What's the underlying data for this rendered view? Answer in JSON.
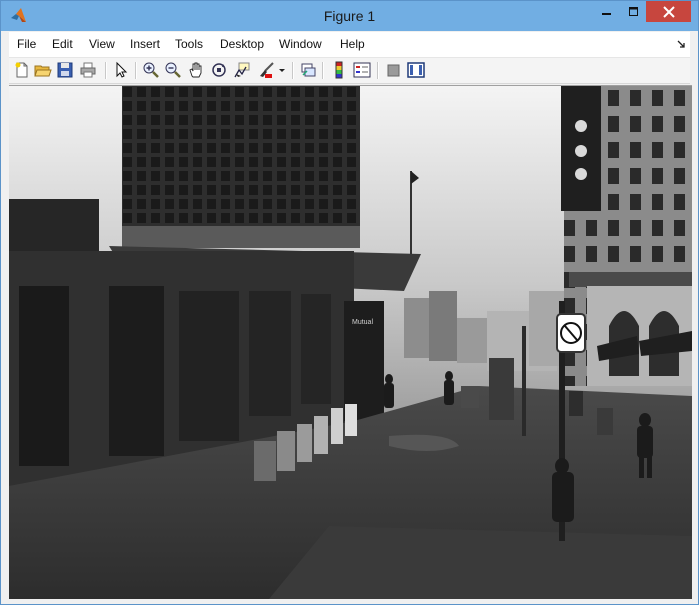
{
  "window": {
    "title": "Figure 1"
  },
  "menubar": {
    "items": [
      "File",
      "Edit",
      "View",
      "Insert",
      "Tools",
      "Desktop",
      "Window",
      "Help"
    ]
  },
  "toolbar": {
    "icons": [
      "new-figure-icon",
      "open-folder-icon",
      "save-icon",
      "print-icon",
      "pointer-icon",
      "zoom-in-icon",
      "zoom-out-icon",
      "pan-hand-icon",
      "rotate-3d-icon",
      "data-cursor-icon",
      "brush-icon",
      "dropdown-arrow-icon",
      "link-plot-icon",
      "colorbar-icon",
      "legend-icon",
      "hide-plot-tools-icon",
      "show-plot-tools-icon"
    ]
  },
  "figure": {
    "image_description": "grayscale street scene",
    "sign_text": "Mutual"
  },
  "colors": {
    "titlebar": "#71aee3",
    "close_button": "#c7463e",
    "menubar": "#ffffff",
    "toolbar": "#f4f4f4"
  }
}
